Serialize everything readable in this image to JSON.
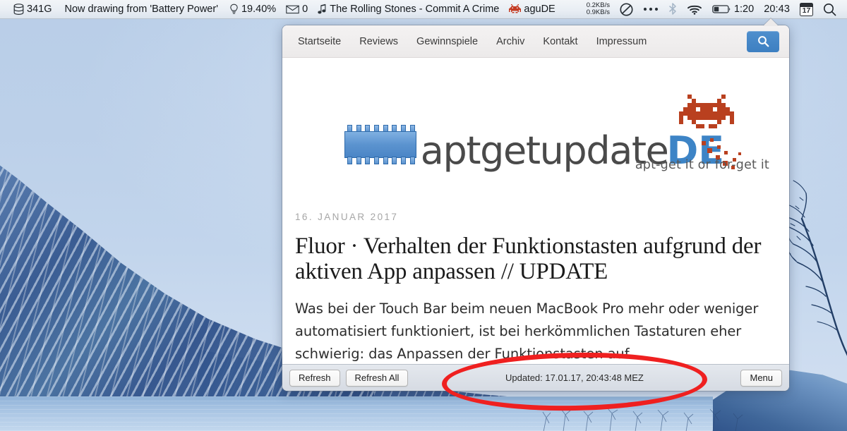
{
  "menubar": {
    "left_items": [
      {
        "icon": "disk-icon",
        "label": "341G"
      },
      {
        "icon": null,
        "label": "Now drawing from 'Battery Power'"
      },
      {
        "icon": "lightbulb-icon",
        "label": "19.40%"
      },
      {
        "icon": "envelope-icon",
        "label": "0"
      },
      {
        "icon": "music-note-icon",
        "label": "The Rolling Stones - Commit A Crime"
      },
      {
        "icon": "space-invader-icon",
        "label": "aguDE"
      }
    ],
    "network_up": "0.2KB/s",
    "network_down": "0.9KB/s",
    "right_items": [
      {
        "icon": "speedometer-icon",
        "label": ""
      },
      {
        "icon": "ellipsis-icon",
        "label": ""
      },
      {
        "icon": "bluetooth-icon",
        "label": ""
      },
      {
        "icon": "wifi-icon",
        "label": ""
      },
      {
        "icon": "battery-icon",
        "label": "1:20"
      }
    ],
    "clock": "20:43",
    "calendar_day": "17",
    "search_icon": "spotlight-search-icon"
  },
  "popup": {
    "nav": {
      "links": [
        "Startseite",
        "Reviews",
        "Gewinnspiele",
        "Archiv",
        "Kontakt",
        "Impressum"
      ],
      "search_button_icon": "magnifier-icon"
    },
    "logo": {
      "word": "aptgetupdate",
      "suffix": "DE",
      "tagline": "apt-get it or for-get it",
      "chip_icon": "cpu-chip-icon",
      "invader_icon": "space-invader-icon"
    },
    "article": {
      "date": "16. JANUAR 2017",
      "title": "Fluor · Verhalten der Funktionstasten aufgrund der aktiven App anpassen // UPDATE",
      "body": "Was bei der Touch Bar beim neuen MacBook Pro mehr oder weniger automatisiert funktioniert, ist bei herkömmlichen Tastaturen eher schwierig: das Anpassen der Funktionstasten auf"
    },
    "toolbar": {
      "refresh_label": "Refresh",
      "refresh_all_label": "Refresh All",
      "status": "Updated: 17.01.17, 20:43:48 MEZ",
      "menu_label": "Menu"
    }
  },
  "annotation": {
    "shape": "ellipse",
    "color": "#ef2020",
    "target": "Updated: 17.01.17, 20:43:48 MEZ"
  }
}
